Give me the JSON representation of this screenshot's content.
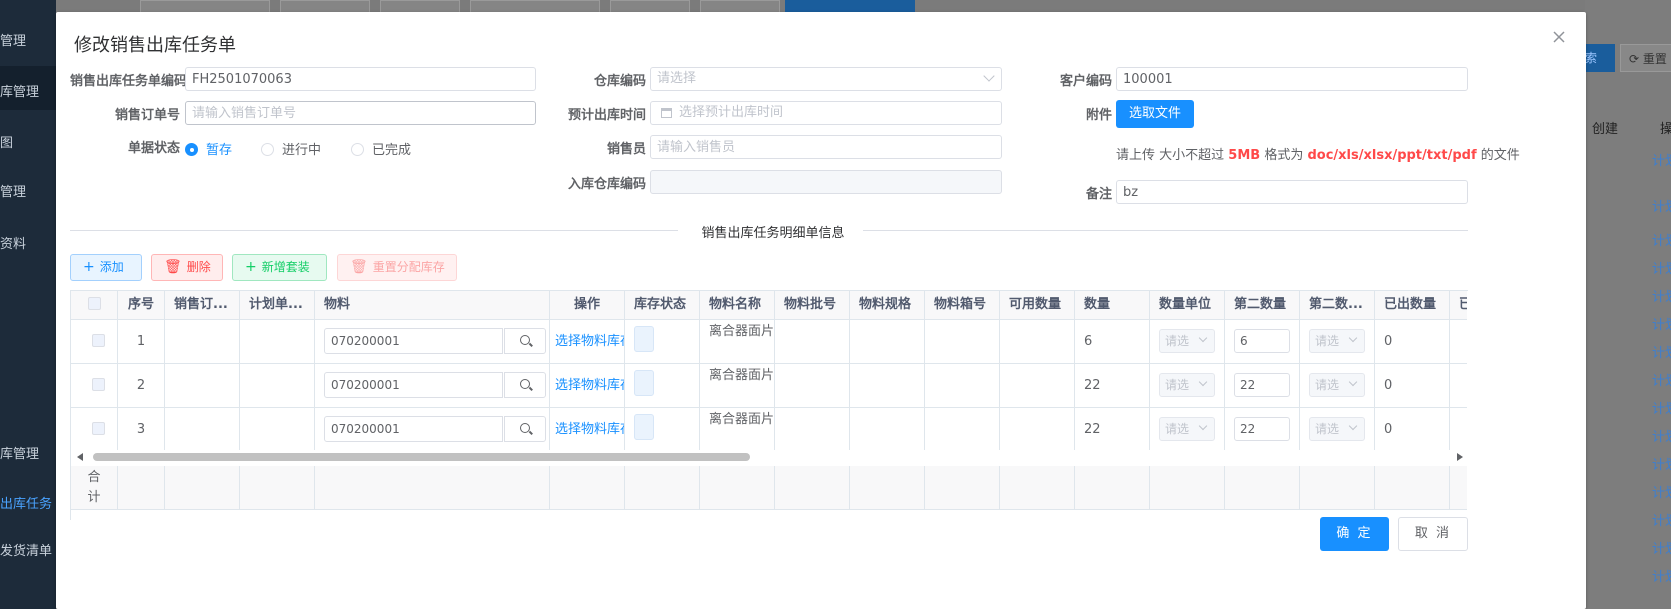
{
  "background": {
    "sidebar_items": [
      "管理",
      "库管理",
      "图",
      "管理",
      "资料",
      "库管理",
      "出库任务",
      "发货清单"
    ],
    "query_button": "索",
    "reset_button": "重置",
    "table_header_create": "创建",
    "table_header_op": "操",
    "link_text": "计划"
  },
  "dialog": {
    "title": "修改销售出库任务单",
    "form": {
      "task_no_label": "销售出库任务单编码",
      "task_no_value": "FH2501070063",
      "sales_order_label": "销售订单号",
      "sales_order_placeholder": "请输入销售订单号",
      "status_label": "单据状态",
      "status_options": [
        "暂存",
        "进行中",
        "已完成"
      ],
      "warehouse_label": "仓库编码",
      "warehouse_placeholder": "请选择",
      "outbound_time_label": "预计出库时间",
      "outbound_time_placeholder": "选择预计出库时间",
      "salesman_label": "销售员",
      "salesman_placeholder": "请输入销售员",
      "in_warehouse_label": "入库仓库编码",
      "customer_label": "客户编码",
      "customer_value": "100001",
      "attachment_label": "附件",
      "choose_file": "选取文件",
      "hint_prefix": "请上传 大小不超过",
      "hint_size": "5MB",
      "hint_mid": "格式为",
      "hint_formats": "doc/xls/xlsx/ppt/txt/pdf",
      "hint_suffix": "的文件",
      "remark_label": "备注",
      "remark_value": "bz"
    },
    "section_title": "销售出库任务明细单信息",
    "toolbar": {
      "add": "添加",
      "delete": "删除",
      "add_kit": "新增套装",
      "realloc": "重置分配库存"
    },
    "table": {
      "headers": [
        "序号",
        "销售订...",
        "计划单...",
        "物料",
        "操作",
        "库存状态",
        "物料名称",
        "物料批号",
        "物料规格",
        "物料箱号",
        "可用数量",
        "数量",
        "数量单位",
        "第二数量",
        "第二数...",
        "已出数量",
        "已"
      ],
      "rows": [
        {
          "no": "1",
          "material": "070200001",
          "op": "选择物料库存",
          "name": "离合器面片",
          "qty": "6",
          "unit": "请选",
          "qty2": "6",
          "unit2": "请选",
          "out": "0"
        },
        {
          "no": "2",
          "material": "070200001",
          "op": "选择物料库存",
          "name": "离合器面片",
          "qty": "22",
          "unit": "请选",
          "qty2": "22",
          "unit2": "请选",
          "out": "0"
        },
        {
          "no": "3",
          "material": "070200001",
          "op": "选择物料库存",
          "name": "离合器面片",
          "qty": "22",
          "unit": "请选",
          "qty2": "22",
          "unit2": "请选",
          "out": "0"
        }
      ],
      "total_label": "合计"
    },
    "confirm": "确 定",
    "cancel": "取 消"
  }
}
